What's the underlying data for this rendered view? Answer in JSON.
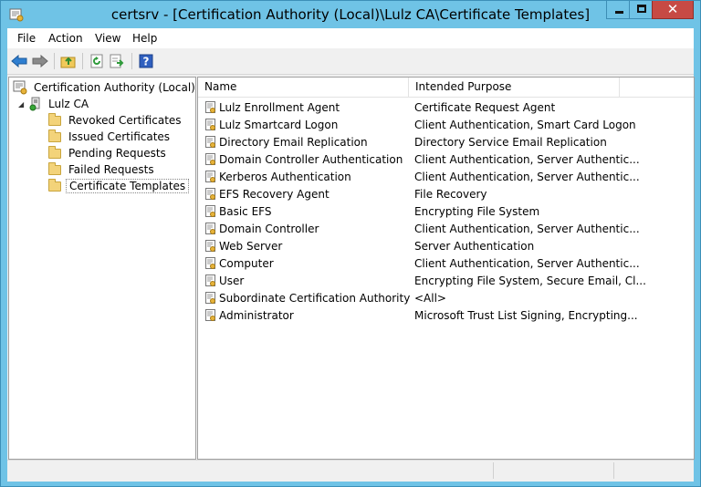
{
  "window": {
    "title": "certsrv - [Certification Authority (Local)\\Lulz CA\\Certificate Templates]",
    "close_glyph": "✕"
  },
  "menu": [
    "File",
    "Action",
    "View",
    "Help"
  ],
  "toolbar": {
    "icons": [
      "back-arrow-icon",
      "forward-arrow-icon",
      "up-folder-icon",
      "refresh-icon",
      "export-list-icon",
      "help-icon"
    ],
    "help_label": "?"
  },
  "tree": {
    "root": "Certification Authority (Local)",
    "ca": "Lulz CA",
    "folders": [
      "Revoked Certificates",
      "Issued Certificates",
      "Pending Requests",
      "Failed Requests",
      "Certificate Templates"
    ],
    "selected": "Certificate Templates"
  },
  "list": {
    "columns": [
      "Name",
      "Intended Purpose"
    ],
    "rows": [
      {
        "name": "Lulz Enrollment Agent",
        "purpose": "Certificate Request Agent"
      },
      {
        "name": "Lulz Smartcard Logon",
        "purpose": "Client Authentication, Smart Card Logon"
      },
      {
        "name": "Directory Email Replication",
        "purpose": "Directory Service Email Replication"
      },
      {
        "name": "Domain Controller Authentication",
        "purpose": "Client Authentication, Server Authentic..."
      },
      {
        "name": "Kerberos Authentication",
        "purpose": "Client Authentication, Server Authentic..."
      },
      {
        "name": "EFS Recovery Agent",
        "purpose": "File Recovery"
      },
      {
        "name": "Basic EFS",
        "purpose": "Encrypting File System"
      },
      {
        "name": "Domain Controller",
        "purpose": "Client Authentication, Server Authentic..."
      },
      {
        "name": "Web Server",
        "purpose": "Server Authentication"
      },
      {
        "name": "Computer",
        "purpose": "Client Authentication, Server Authentic..."
      },
      {
        "name": "User",
        "purpose": "Encrypting File System, Secure Email, Cl..."
      },
      {
        "name": "Subordinate Certification Authority",
        "purpose": "<All>"
      },
      {
        "name": "Administrator",
        "purpose": "Microsoft Trust List Signing, Encrypting..."
      }
    ]
  },
  "colors": {
    "window_frame": "#6fc3e6",
    "close_button": "#c74a44"
  }
}
